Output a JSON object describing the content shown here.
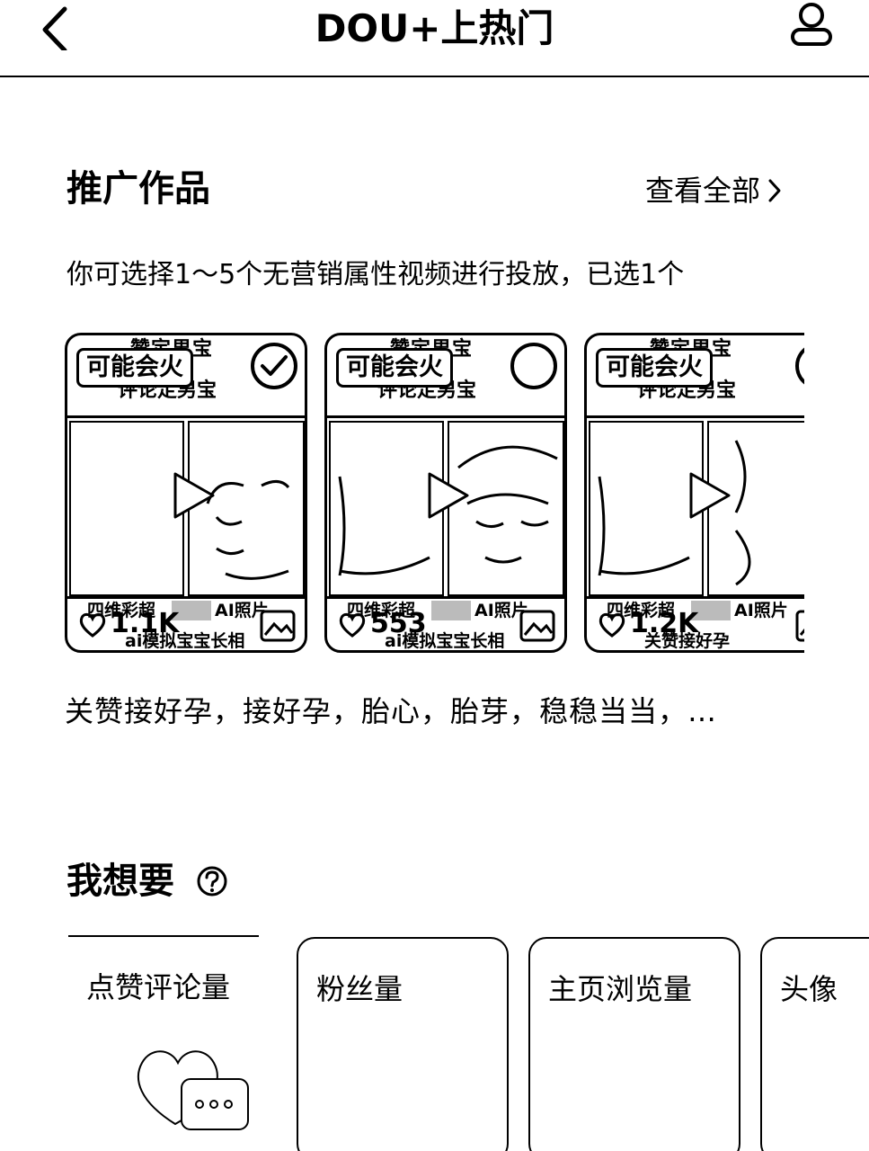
{
  "header": {
    "title": "DOU+上热门",
    "back_icon": "chevron-left-icon",
    "profile_icon": "user-icon"
  },
  "promo": {
    "title": "推广作品",
    "view_all": "查看全部",
    "hint": "你可选择1～5个无营销属性视频进行投放，已选1个",
    "caption": "关赞接好孕，接好孕，胎心，胎芽，稳稳当当，…",
    "cards": [
      {
        "badge": "可能会火",
        "top_text_1": "赞定男宝",
        "top_text_2": "评论定男宝",
        "selected": true,
        "bottom_text_1": "四维彩超",
        "bottom_text_1b": "AI照片",
        "likes": "1.1K",
        "bottom_text_2": "ai模拟宝宝长相"
      },
      {
        "badge": "可能会火",
        "top_text_1": "赞定男宝",
        "top_text_2": "评论定男宝",
        "selected": false,
        "bottom_text_1": "四维彩超",
        "bottom_text_1b": "AI照片",
        "likes": "553",
        "bottom_text_2": "ai模拟宝宝长相"
      },
      {
        "badge": "可能会火",
        "top_text_1": "赞定男宝",
        "top_text_2": "评论定男宝",
        "selected": false,
        "bottom_text_1": "四维彩超",
        "bottom_text_1b": "AI照片",
        "likes": "1.2K",
        "bottom_text_2": "关赞接好孕"
      }
    ]
  },
  "goals": {
    "title": "我想要",
    "options": [
      {
        "label": "点赞评论量",
        "selected": true
      },
      {
        "label": "粉丝量",
        "selected": false
      },
      {
        "label": "主页浏览量",
        "selected": false
      },
      {
        "label": "头像",
        "selected": false
      }
    ]
  }
}
